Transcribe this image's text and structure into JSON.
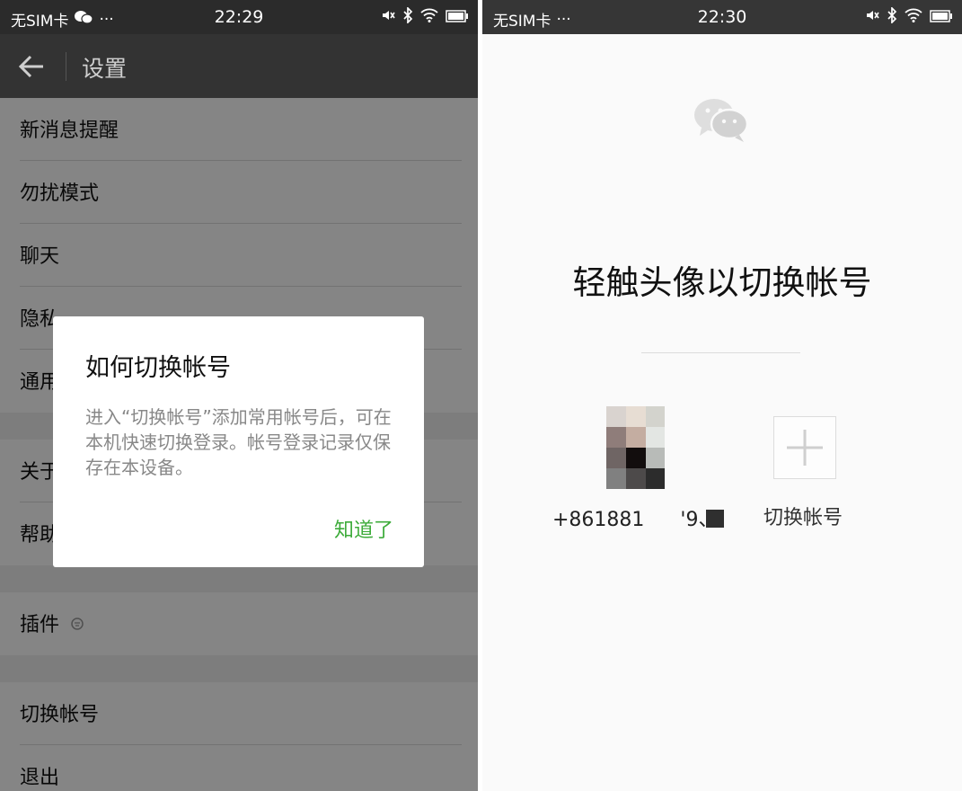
{
  "left_screen": {
    "status": {
      "carrier": "无SIM卡",
      "dots": "···",
      "time": "22:29"
    },
    "title": "设置",
    "rows": [
      {
        "label": "新消息提醒"
      },
      {
        "label": "勿扰模式"
      },
      {
        "label": "聊天"
      },
      {
        "label": "隐私"
      },
      {
        "label": "通用"
      },
      {
        "label": "关于"
      },
      {
        "label": "帮助"
      },
      {
        "label": "插件"
      },
      {
        "label": "切换帐号"
      },
      {
        "label": "退出"
      }
    ],
    "dialog": {
      "title": "如何切换帐号",
      "body": "进入“切换帐号”添加常用帐号后，可在本机快速切换登录。帐号登录记录仅保存在本设备。",
      "confirm": "知道了"
    }
  },
  "right_screen": {
    "status": {
      "carrier": "无SIM卡",
      "dots": "···",
      "time": "22:30"
    },
    "headline": "轻触头像以切换帐号",
    "account_phone": "+861881",
    "account_phone_tail": "'9、",
    "add_label": "切换帐号"
  },
  "colors": {
    "accent_green": "#3dab3a",
    "titlebar": "#333333",
    "overlay": "rgba(0,0,0,0.48)"
  },
  "icons": [
    "back-arrow-icon",
    "wechat-status-icon",
    "mute-icon",
    "bluetooth-icon",
    "wifi-icon",
    "battery-icon",
    "plugin-icon",
    "wechat-logo-icon",
    "plus-icon"
  ]
}
